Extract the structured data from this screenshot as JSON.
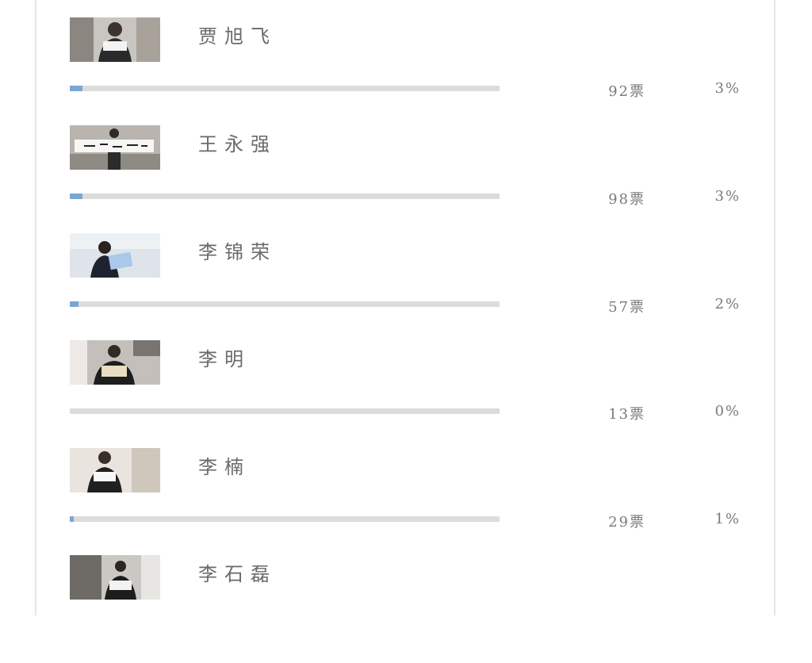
{
  "colors": {
    "bar_fill": "#7aa6d4",
    "bar_track": "#dcdcdc",
    "text": "#6a6a6a"
  },
  "candidates": [
    {
      "name": "贾旭飞",
      "votes": "92票",
      "percent": "3%",
      "share": 0.03
    },
    {
      "name": "王永强",
      "votes": "98票",
      "percent": "3%",
      "share": 0.03
    },
    {
      "name": "李锦荣",
      "votes": "57票",
      "percent": "2%",
      "share": 0.02
    },
    {
      "name": "李明",
      "votes": "13票",
      "percent": "0%",
      "share": 0.0
    },
    {
      "name": "李楠",
      "votes": "29票",
      "percent": "1%",
      "share": 0.01
    },
    {
      "name": "李石磊",
      "votes": null,
      "percent": null,
      "share": null
    }
  ]
}
